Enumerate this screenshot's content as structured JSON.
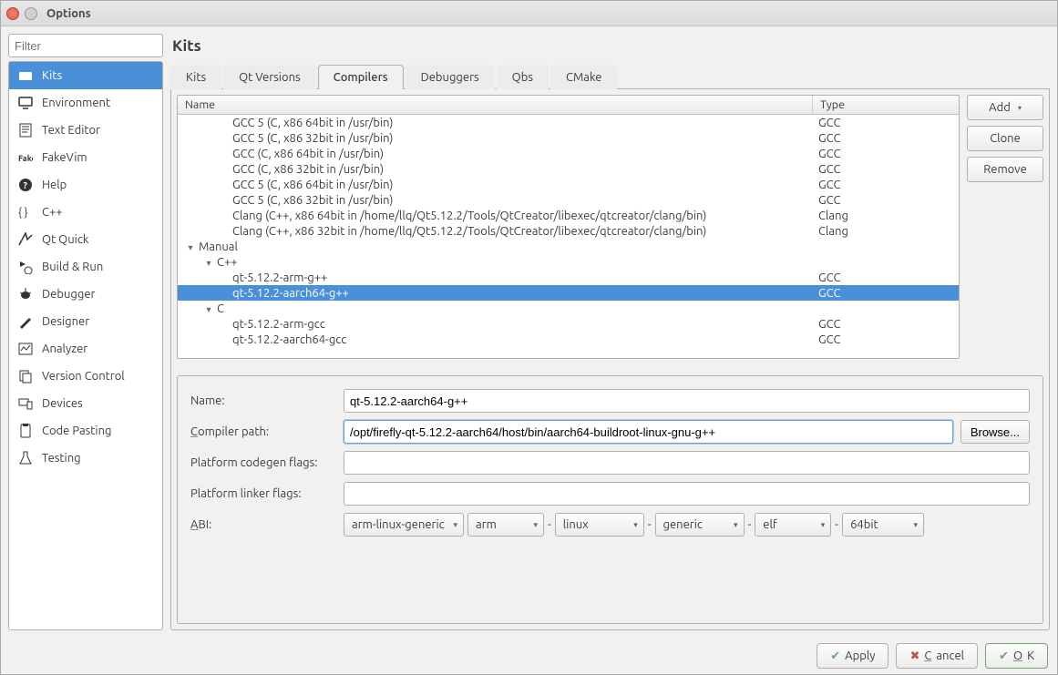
{
  "window": {
    "title": "Options"
  },
  "sidebar": {
    "filter_placeholder": "Filter",
    "items": [
      {
        "label": "Kits",
        "icon": "kits"
      },
      {
        "label": "Environment",
        "icon": "monitor"
      },
      {
        "label": "Text Editor",
        "icon": "texteditor"
      },
      {
        "label": "FakeVim",
        "icon": "fakevim"
      },
      {
        "label": "Help",
        "icon": "help"
      },
      {
        "label": "C++",
        "icon": "braces"
      },
      {
        "label": "Qt Quick",
        "icon": "qtquick"
      },
      {
        "label": "Build & Run",
        "icon": "buildrun"
      },
      {
        "label": "Debugger",
        "icon": "debugger"
      },
      {
        "label": "Designer",
        "icon": "designer"
      },
      {
        "label": "Analyzer",
        "icon": "analyzer"
      },
      {
        "label": "Version Control",
        "icon": "vcs"
      },
      {
        "label": "Devices",
        "icon": "devices"
      },
      {
        "label": "Code Pasting",
        "icon": "codepaste"
      },
      {
        "label": "Testing",
        "icon": "testing"
      }
    ],
    "selected": 0
  },
  "page": {
    "title": "Kits",
    "tabs": [
      "Kits",
      "Qt Versions",
      "Compilers",
      "Debuggers",
      "Qbs",
      "CMake"
    ],
    "active_tab": 2
  },
  "compilers": {
    "columns": {
      "name": "Name",
      "type": "Type"
    },
    "buttons": {
      "add": "Add",
      "clone": "Clone",
      "remove": "Remove"
    },
    "rows": [
      {
        "indent": 60,
        "exp": "",
        "name": "GCC 5 (C, x86 64bit in /usr/bin)",
        "type": "GCC"
      },
      {
        "indent": 60,
        "exp": "",
        "name": "GCC 5 (C, x86 32bit in /usr/bin)",
        "type": "GCC"
      },
      {
        "indent": 60,
        "exp": "",
        "name": "GCC (C, x86 64bit in /usr/bin)",
        "type": "GCC"
      },
      {
        "indent": 60,
        "exp": "",
        "name": "GCC (C, x86 32bit in /usr/bin)",
        "type": "GCC"
      },
      {
        "indent": 60,
        "exp": "",
        "name": "GCC 5 (C, x86 64bit in /usr/bin)",
        "type": "GCC"
      },
      {
        "indent": 60,
        "exp": "",
        "name": "GCC 5 (C, x86 32bit in /usr/bin)",
        "type": "GCC"
      },
      {
        "indent": 60,
        "exp": "",
        "name": "Clang (C++, x86 64bit in /home/llq/Qt5.12.2/Tools/QtCreator/libexec/qtcreator/clang/bin)",
        "type": "Clang"
      },
      {
        "indent": 60,
        "exp": "",
        "name": "Clang (C++, x86 32bit in /home/llq/Qt5.12.2/Tools/QtCreator/libexec/qtcreator/clang/bin)",
        "type": "Clang"
      },
      {
        "indent": 8,
        "exp": "▾",
        "name": "Manual",
        "type": ""
      },
      {
        "indent": 28,
        "exp": "▾",
        "name": "C++",
        "type": ""
      },
      {
        "indent": 60,
        "exp": "",
        "name": "qt-5.12.2-arm-g++",
        "type": "GCC"
      },
      {
        "indent": 60,
        "exp": "",
        "name": "qt-5.12.2-aarch64-g++",
        "type": "GCC",
        "selected": true
      },
      {
        "indent": 28,
        "exp": "▾",
        "name": "C",
        "type": ""
      },
      {
        "indent": 60,
        "exp": "",
        "name": "qt-5.12.2-arm-gcc",
        "type": "GCC"
      },
      {
        "indent": 60,
        "exp": "",
        "name": "qt-5.12.2-aarch64-gcc",
        "type": "GCC"
      }
    ]
  },
  "detail": {
    "labels": {
      "name": "Name:",
      "compiler_path": "Compiler path:",
      "codegen": "Platform codegen flags:",
      "linker": "Platform linker flags:",
      "abi": "ABI:",
      "browse": "Browse..."
    },
    "name_value": "qt-5.12.2-aarch64-g++",
    "path_value": "/opt/firefly-qt-5.12.2-aarch64/host/bin/aarch64-buildroot-linux-gnu-g++",
    "codegen_value": "",
    "linker_value": "",
    "abi": {
      "preset": "arm-linux-generic",
      "arch": "arm",
      "os": "linux",
      "flavor": "generic",
      "format": "elf",
      "width": "64bit"
    }
  },
  "bottom": {
    "apply": "Apply",
    "cancel": "Cancel",
    "ok": "OK"
  }
}
